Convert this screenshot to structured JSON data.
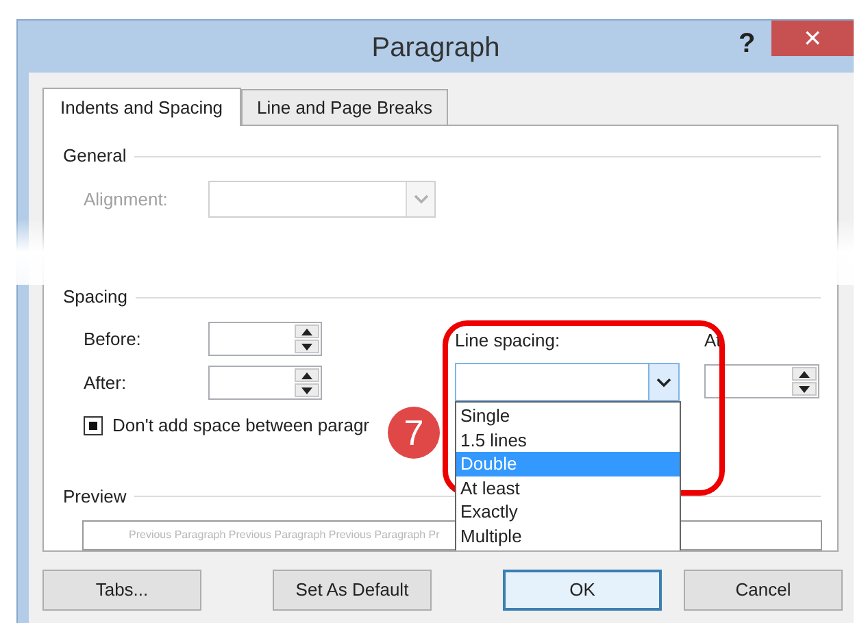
{
  "window": {
    "title": "Paragraph",
    "help": "?",
    "close": "×"
  },
  "tabs": [
    {
      "label": "Indents and Spacing",
      "selected": true
    },
    {
      "label": "Line and Page Breaks",
      "selected": false
    }
  ],
  "general": {
    "heading": "General",
    "alignment_label": "Alignment:",
    "alignment_disabled": true
  },
  "spacing": {
    "heading": "Spacing",
    "before_label": "Before:",
    "after_label": "After:",
    "line_spacing_label": "Line spacing:",
    "at_label": "At",
    "line_spacing_options": [
      {
        "label": "Single",
        "selected": false
      },
      {
        "label": "1.5 lines",
        "selected": false
      },
      {
        "label": "Double",
        "selected": true
      },
      {
        "label": "At least",
        "selected": false
      },
      {
        "label": "Exactly",
        "selected": false
      },
      {
        "label": "Multiple",
        "selected": false
      }
    ],
    "no_space_checkbox": {
      "label": "Don't add space between paragr",
      "indeterminate": true
    }
  },
  "preview": {
    "heading": "Preview",
    "text": "Previous Paragraph Previous Paragraph Previous Paragraph Pr"
  },
  "step_badge": "7",
  "buttons": [
    {
      "label": "Tabs...",
      "default": false
    },
    {
      "label": "Set As Default",
      "default": false
    },
    {
      "label": "OK",
      "default": true
    },
    {
      "label": "Cancel",
      "default": false
    }
  ]
}
